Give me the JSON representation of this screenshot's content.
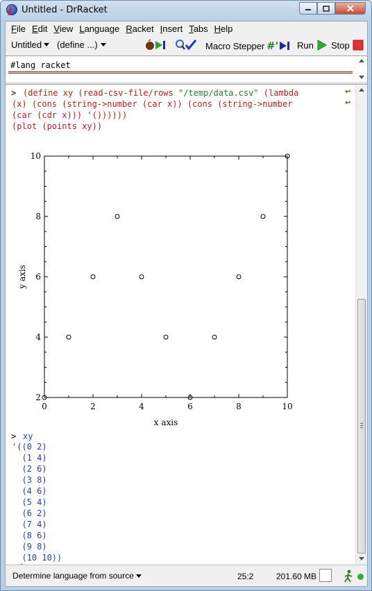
{
  "window": {
    "title": "Untitled - DrRacket"
  },
  "menu": [
    {
      "label": "File",
      "u": "F",
      "rest": "ile"
    },
    {
      "label": "Edit",
      "u": "E",
      "rest": "dit"
    },
    {
      "label": "View",
      "u": "V",
      "rest": "iew"
    },
    {
      "label": "Language",
      "u": "L",
      "rest": "anguage"
    },
    {
      "label": "Racket",
      "u": "R",
      "rest": "acket"
    },
    {
      "label": "Insert",
      "u": "I",
      "rest": "nsert"
    },
    {
      "label": "Tabs",
      "u": "T",
      "rest": "abs"
    },
    {
      "label": "Help",
      "u": "H",
      "rest": "elp"
    }
  ],
  "toolbar": {
    "file_dropdown": "Untitled",
    "define_dropdown": "(define ...)",
    "macro_stepper": "Macro Stepper",
    "run": "Run",
    "stop": "Stop"
  },
  "definitions": {
    "text": "#lang racket"
  },
  "interactions": {
    "prompt": ">",
    "line1": "(define xy (read-csv-file/rows \"/temp/data.csv\" (lambda",
    "line1_parts": {
      "a": "(define xy (read-csv-file/rows ",
      "b": "\"/temp/data.csv\"",
      "c": " (lambda"
    },
    "line2": "(x) (cons (string->number (car x)) (cons (string->number",
    "line3": "(car (cdr x))) '())))))",
    "line4": "(plot (points xy))",
    "cmd2": "xy",
    "output": [
      "'((0 2)",
      "  (1 4)",
      "  (2 6)",
      "  (3 8)",
      "  (4 6)",
      "  (5 4)",
      "  (6 2)",
      "  (7 4)",
      "  (8 6)",
      "  (9 8)",
      "  (10 10))"
    ]
  },
  "chart_data": {
    "type": "scatter",
    "xlabel": "x axis",
    "ylabel": "y axis",
    "xlim": [
      0,
      10
    ],
    "ylim": [
      2,
      10
    ],
    "x_ticks": [
      0,
      2,
      4,
      6,
      8,
      10
    ],
    "y_ticks": [
      2,
      4,
      6,
      8,
      10
    ],
    "x": [
      0,
      1,
      2,
      3,
      4,
      5,
      6,
      7,
      8,
      9,
      10
    ],
    "y": [
      2,
      4,
      6,
      8,
      6,
      4,
      2,
      4,
      6,
      8,
      10
    ]
  },
  "status": {
    "language": "Determine language from source",
    "position": "25:2",
    "memory": "201.60 MB"
  }
}
